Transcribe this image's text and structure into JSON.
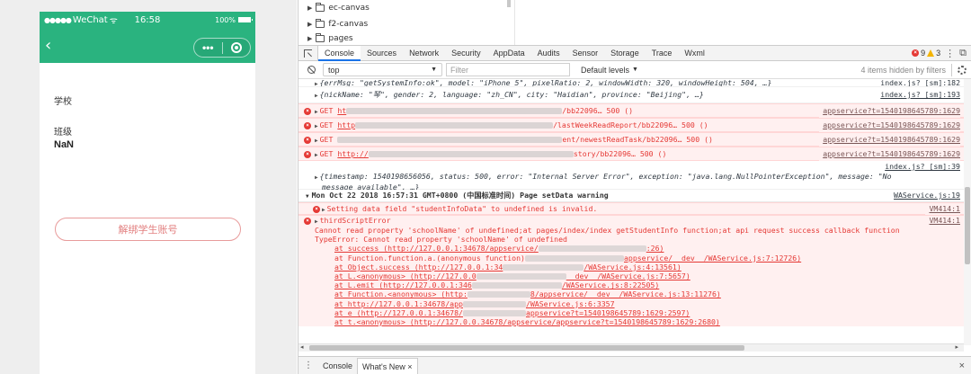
{
  "simulator": {
    "status_bar": {
      "carrier": "WeChat",
      "signal": "●●●●●",
      "time": "16:58",
      "battery": "100%"
    },
    "nav": {
      "back_glyph": "‹",
      "more_glyph": "•••"
    },
    "fields": {
      "school_label": "学校",
      "class_label": "班级",
      "class_value": "NaN"
    },
    "unbind_button": "解绑学生账号"
  },
  "devtools": {
    "file_tree": [
      "ec-canvas",
      "f2-canvas",
      "pages"
    ],
    "tabs": [
      "Console",
      "Sources",
      "Network",
      "Security",
      "AppData",
      "Audits",
      "Sensor",
      "Storage",
      "Trace",
      "Wxml"
    ],
    "active_tab": "Console",
    "error_count": "9",
    "warning_count": "3",
    "context": "top",
    "filter_placeholder": "Filter",
    "levels": "Default levels",
    "hidden_text": "4 items hidden by filters",
    "drawer": {
      "tabs": [
        "Console",
        "What's New"
      ],
      "close_glyph": "×"
    }
  },
  "console": {
    "line1": {
      "text": "{errMsg: \"getSystemInfo:ok\", model: \"iPhone 5\", pixelRatio: 2, windowWidth: 320, windowHeight: 504, …}",
      "src": "index.js? [sm]:182"
    },
    "line2": {
      "text": "{nickName: \"琴\", gender: 2, language: \"zh_CN\", city: \"Haidian\", province: \"Beijing\", …}",
      "src": "index.js? [sm]:193"
    },
    "get_rows": [
      {
        "prefix": "GET",
        "a": "ht",
        "b": "/bb22096… 500 ()",
        "src": "appservice?t=1540198645789:1629"
      },
      {
        "prefix": "GET",
        "a": "http",
        "b": "/lastWeekReadReport/bb22096… 500 ()",
        "src": "appservice?t=1540198645789:1629"
      },
      {
        "prefix": "GET",
        "a": "",
        "b": "ent/newestReadTask/bb22096… 500 ()",
        "src": "appservice?t=1540198645789:1629"
      },
      {
        "prefix": "GET",
        "a": "http://",
        "b": "story/bb22096… 500 ()",
        "src": "appservice?t=1540198645789:1629"
      }
    ],
    "line_ts_src": "index.js? [sm]:39",
    "line_ts": "{timestamp: 1540198656056, status: 500, error: \"Internal Server Error\", exception: \"java.lang.NullPointerException\", message: \"No",
    "line_ts2": "message available\", …}",
    "group": {
      "text": "Mon Oct 22 2018 16:57:31 GMT+0800 (中国标准时间) Page setData warning",
      "src": "WAService.js:19"
    },
    "setdata": {
      "text": "Setting data field \"studentInfoData\" to undefined is invalid.",
      "src": "VM414:1"
    },
    "third": {
      "text": "thirdScriptError",
      "src": "VM414:1"
    },
    "cannot": "Cannot read property 'schoolName' of undefined;at pages/index/index getStudentInfo function;at api request success callback function",
    "typeerror": "TypeError: Cannot read property 'schoolName' of undefined",
    "stack": [
      "at success (http://127.0.0.1:34678/appservice/",
      "at Function.function.a.(anonymous function)",
      "at Object.success (http://127.0.0.1:34",
      "at L.<anonymous> (http://127.0.0",
      "at L.emit (http://127.0.0.1:346",
      "at Function.<anonymous> (http:",
      "at http://127.0.0.1:34678/app",
      "at e (http://127.0.0.1:34678/",
      "at t.<anonymous> (http://127.0.0."
    ],
    "stack_tail": [
      ":26)",
      "appservice/__dev__/WAService.js:7:12726)",
      "/WAService.js:4:13561)",
      "__dev__/WAService.js:7:5657)",
      "/WAService.js:8:22505)",
      "8/appservice/__dev__/WAService.js:13:11276)",
      "/WAService.js:6:3357",
      "appservice?t=1540198645789:1629:2597)",
      "34678/appservice/appservice?t=1540198645789:1629:2680)"
    ]
  },
  "colors": {
    "nav_green": "#2ab37f",
    "error_red": "#e53935",
    "error_bg": "#fff0f0",
    "accent_blue": "#1a73e8"
  }
}
